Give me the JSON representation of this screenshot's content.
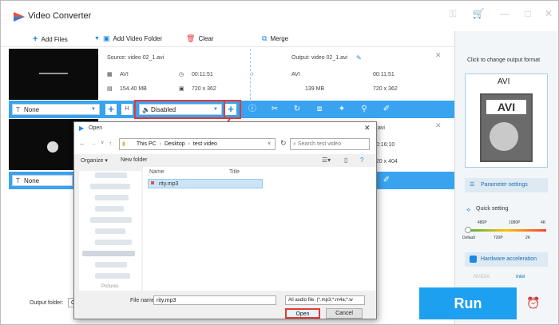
{
  "app": {
    "title": "Video Converter"
  },
  "toolbar": {
    "add_files": "Add Files",
    "add_folder": "Add Video Folder",
    "clear": "Clear",
    "merge": "Merge"
  },
  "video1": {
    "source": "Source: video 02_1.avi",
    "output": "Output: video 02_1.avi",
    "src_format": "AVI",
    "src_duration": "00:11:51",
    "src_size": "154.40 MB",
    "src_res": "720 x 362",
    "out_format": "AVI",
    "out_duration": "00:11:51",
    "out_size": "139 MB",
    "out_res": "720 x 362",
    "subtitle": "None",
    "audio": "Disabled"
  },
  "video2": {
    "output_suffix": "avi",
    "duration": "00:16:10",
    "res": "720 x 404",
    "subtitle": "None"
  },
  "right": {
    "hint": "Click to change output format",
    "format": "AVI",
    "param": "Parameter settings",
    "quick": "Quick setting",
    "q_top": [
      "480P",
      "1080P",
      "4K"
    ],
    "q_bottom": [
      "Default",
      "720P",
      "2K"
    ],
    "hw": "Hardware acceleration",
    "nvidia": "NVIDIA",
    "intel": "Intel"
  },
  "footer": {
    "output_folder": "Output folder:",
    "output_prefix": "C:",
    "run": "Run"
  },
  "dialog": {
    "title": "Open",
    "path": [
      "This PC",
      "Desktop",
      "test video"
    ],
    "search_placeholder": "Search test video",
    "organize": "Organize",
    "new_folder": "New folder",
    "col_name": "Name",
    "col_title": "Title",
    "file": "rity.mp3",
    "filename_label": "File name:",
    "filename_value": "rity.mp3",
    "filter": "All audio file. (*.mp3;*.m4a;*.w",
    "open": "Open",
    "cancel": "Cancel",
    "tree_partial": "Pictures"
  }
}
